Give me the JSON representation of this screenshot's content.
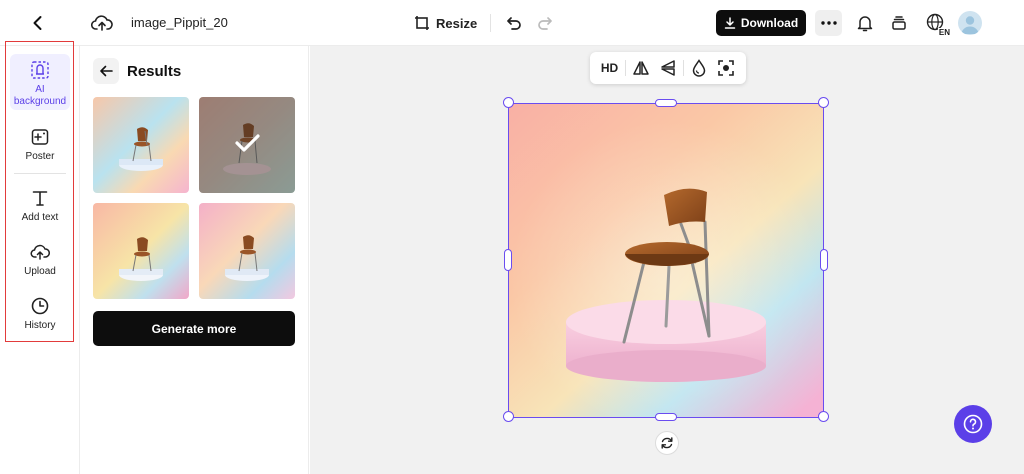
{
  "header": {
    "project_title": "image_Pippit_20",
    "resize_label": "Resize",
    "download_label": "Download",
    "lang_code": "EN"
  },
  "rail": {
    "items": [
      {
        "label": "AI background",
        "icon": "ai-background-icon",
        "active": true
      },
      {
        "label": "Poster",
        "icon": "poster-icon",
        "active": false
      },
      {
        "label": "Add text",
        "icon": "text-icon",
        "active": false
      },
      {
        "label": "Upload",
        "icon": "upload-icon",
        "active": false
      },
      {
        "label": "History",
        "icon": "history-icon",
        "active": false
      }
    ]
  },
  "results": {
    "title": "Results",
    "generate_label": "Generate more",
    "selected_index": 1
  },
  "toolbar": {
    "hd_label": "HD"
  },
  "colors": {
    "accent": "#5b3fe8",
    "selection": "#6a4cf0",
    "highlight_frame": "#e23b3b",
    "dark_button": "#0d0d0d"
  }
}
